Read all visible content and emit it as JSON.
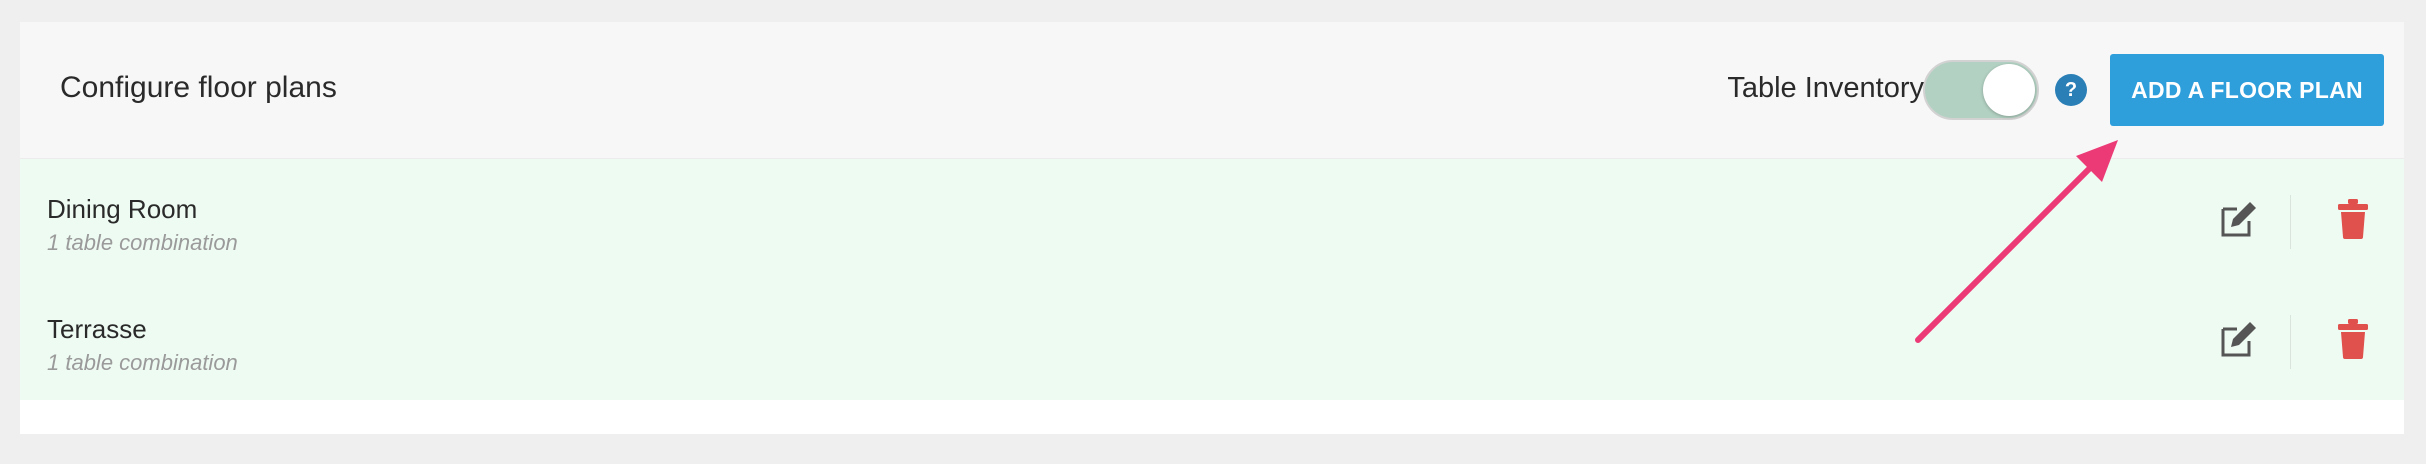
{
  "header": {
    "title": "Configure floor plans",
    "table_inventory_label": "Table Inventory",
    "table_inventory_enabled": true,
    "help_symbol": "?",
    "add_button_label": "ADD A FLOOR PLAN"
  },
  "floor_plans": [
    {
      "name": "Dining Room",
      "subtitle": "1 table combination"
    },
    {
      "name": "Terrasse",
      "subtitle": "1 table combination"
    }
  ],
  "icons": {
    "edit": "edit-icon",
    "delete": "trash-icon",
    "help": "question-mark-icon"
  },
  "colors": {
    "accent": "#2f9fdc",
    "toggle_on": "#b2d1c2",
    "list_background": "#eefbf3",
    "delete": "#e0504c",
    "annotation_arrow": "#ec3a77"
  }
}
